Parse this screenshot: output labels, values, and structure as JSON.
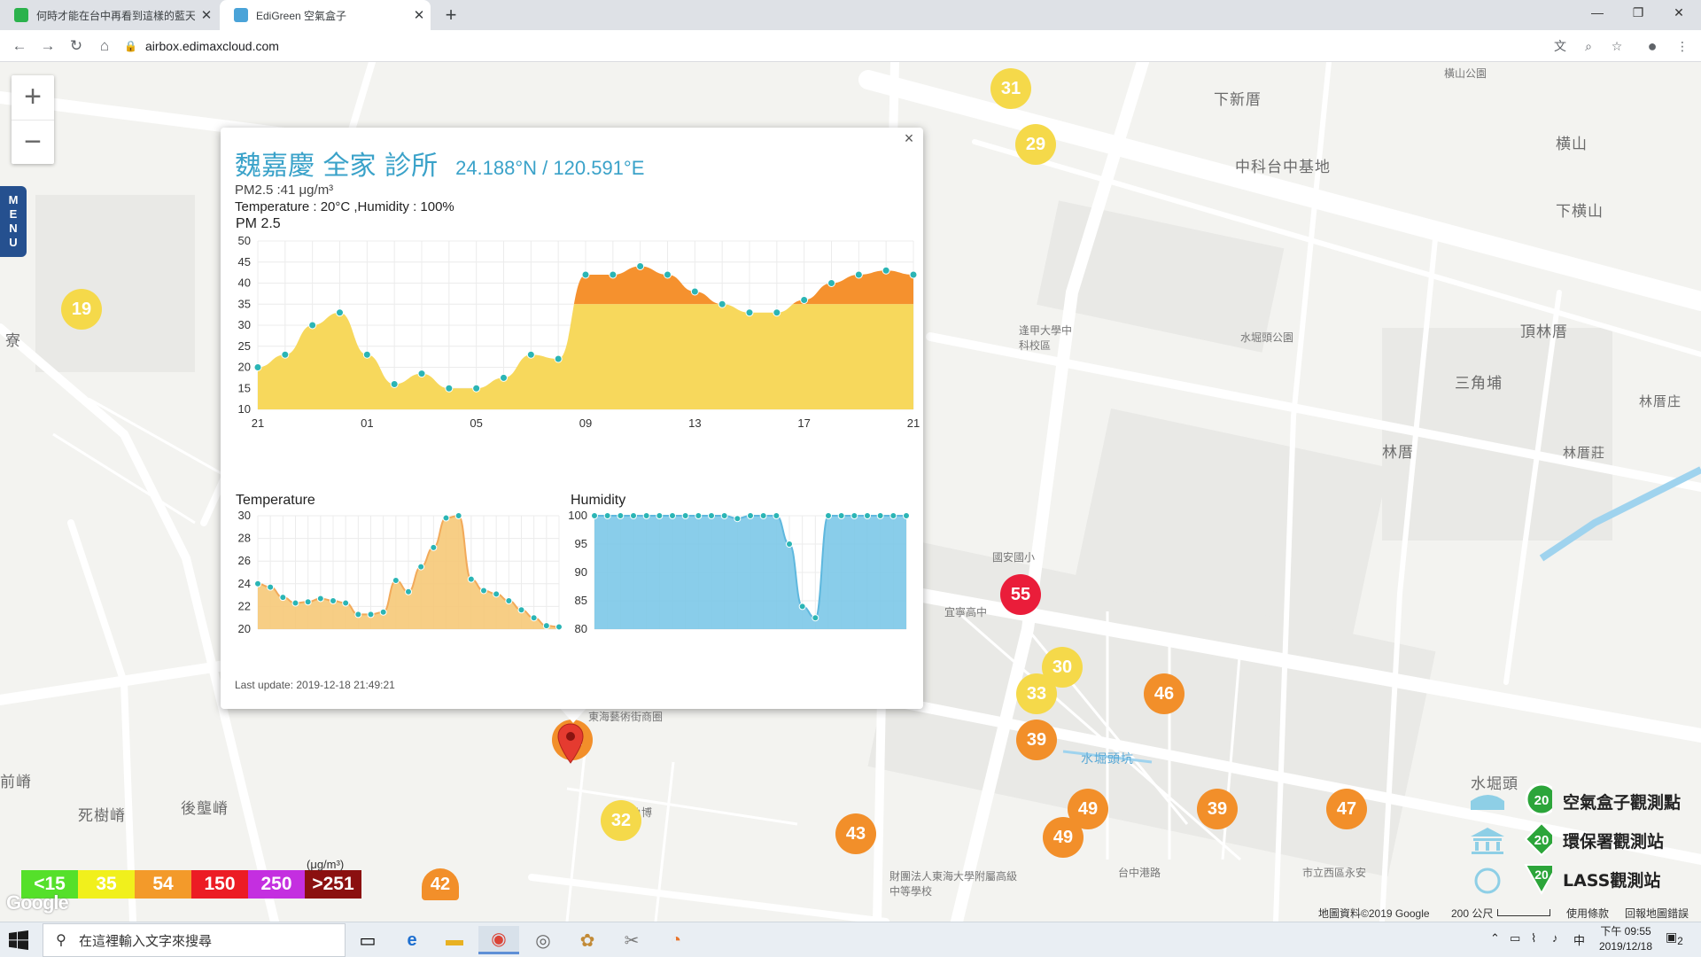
{
  "browser": {
    "tabs": [
      {
        "title": "何時才能在台中再看到這樣的藍天",
        "active": false
      },
      {
        "title": "EdiGreen 空氣盒子",
        "active": true
      }
    ],
    "url": "airbox.edimaxcloud.com"
  },
  "map": {
    "menu_label": "MENU",
    "zoom_in": "+",
    "zoom_out": "−",
    "labels": [
      {
        "text": "下新厝"
      },
      {
        "text": "中科台中基地"
      },
      {
        "text": "横山"
      },
      {
        "text": "下横山"
      },
      {
        "text": "頂林厝"
      },
      {
        "text": "三角埔"
      },
      {
        "text": "林厝"
      },
      {
        "text": "林厝庄"
      },
      {
        "text": "林厝莊"
      },
      {
        "text": "前嵴"
      },
      {
        "text": "死樹嵴"
      },
      {
        "text": "後壟嵴"
      },
      {
        "text": "水堀頭"
      },
      {
        "text": "水堀頭坑"
      },
      {
        "text": "寮"
      },
      {
        "text": "橫山公園"
      },
      {
        "text": "水堀頭公園"
      },
      {
        "text": "逢甲大學中科校區"
      },
      {
        "text": "國安國小"
      },
      {
        "text": "東海藝術街商圈"
      },
      {
        "text": "鯊魚博"
      },
      {
        "text": "財團法人東海大學附屬高級中等學校"
      },
      {
        "text": "台中港路"
      },
      {
        "text": "市立西區永安"
      },
      {
        "text": "宜寧高中"
      }
    ],
    "markers": [
      {
        "value": "31",
        "level": "yellow"
      },
      {
        "value": "29",
        "level": "yellow"
      },
      {
        "value": "19",
        "level": "yellow"
      },
      {
        "value": "55",
        "level": "red"
      },
      {
        "value": "30",
        "level": "yellow"
      },
      {
        "value": "33",
        "level": "yellow"
      },
      {
        "value": "46",
        "level": "orange"
      },
      {
        "value": "39",
        "level": "orange"
      },
      {
        "value": "41",
        "level": "orange"
      },
      {
        "value": "32",
        "level": "yellow"
      },
      {
        "value": "43",
        "level": "orange"
      },
      {
        "value": "49",
        "level": "orange"
      },
      {
        "value": "49",
        "level": "orange"
      },
      {
        "value": "39",
        "level": "orange"
      },
      {
        "value": "47",
        "level": "orange"
      },
      {
        "value": "42",
        "level": "orange"
      }
    ]
  },
  "popup": {
    "station": "魏嘉慶 全家 診所",
    "coords": "24.188°N / 120.591°E",
    "pm_line": "PM2.5 :41 μg/m³",
    "th_line": "Temperature : 20°C ,Humidity : 100%",
    "last_update": "Last update: 2019-12-18 21:49:21",
    "close": "×"
  },
  "chart_data": [
    {
      "type": "area",
      "title": "PM 2.5",
      "x_ticks": [
        "21",
        "01",
        "05",
        "09",
        "13",
        "17",
        "21"
      ],
      "ylim": [
        10,
        50
      ],
      "y_ticks": [
        10,
        15,
        20,
        25,
        30,
        35,
        40,
        45,
        50
      ],
      "values": [
        20,
        23,
        30,
        33,
        23,
        16,
        18.5,
        15,
        15,
        17.5,
        23,
        22,
        42,
        42,
        44,
        42,
        38,
        35,
        33,
        33,
        36,
        40,
        42,
        43,
        42
      ],
      "color_fill": "#f7d85c",
      "color_high": "#f5912e",
      "high_threshold": 35
    },
    {
      "type": "area",
      "title": "Temperature",
      "ylim": [
        20,
        30
      ],
      "y_ticks": [
        20,
        22,
        24,
        26,
        28,
        30
      ],
      "values": [
        24,
        23.7,
        22.8,
        22.3,
        22.4,
        22.7,
        22.5,
        22.3,
        21.3,
        21.3,
        21.5,
        24.3,
        23.3,
        25.5,
        27.2,
        29.8,
        30,
        24.4,
        23.4,
        23.1,
        22.5,
        21.7,
        21,
        20.3,
        20.2
      ],
      "color_fill": "#f6c978",
      "color_line": "#f2aa5a"
    },
    {
      "type": "area",
      "title": "Humidity",
      "ylim": [
        80,
        100
      ],
      "y_ticks": [
        80,
        85,
        90,
        95,
        100
      ],
      "values": [
        100,
        100,
        100,
        100,
        100,
        100,
        100,
        100,
        100,
        100,
        100,
        99.5,
        100,
        100,
        100,
        95,
        84,
        82,
        100,
        100,
        100,
        100,
        100,
        100,
        100
      ],
      "color_fill": "#7cc8e8",
      "color_line": "#5fb8de"
    }
  ],
  "legend": {
    "unit": "(μg/m³)",
    "scale": [
      {
        "label": "<15",
        "color": "#55e02a"
      },
      {
        "label": "35",
        "color": "#f1f01c"
      },
      {
        "label": "54",
        "color": "#f39a2a"
      },
      {
        "label": "150",
        "color": "#ec1c24"
      },
      {
        "label": "250",
        "color": "#c42fe0"
      },
      {
        "label": ">251",
        "color": "#8b1010"
      }
    ],
    "stations": [
      {
        "value": "20",
        "label": "空氣盒子觀測點"
      },
      {
        "value": "20",
        "label": "環保署觀測站"
      },
      {
        "value": "20",
        "label": "LASS觀測站"
      }
    ],
    "google": "Google"
  },
  "attribution": {
    "data": "地圖資料©2019 Google",
    "scale": "200 公尺",
    "terms": "使用條款",
    "report": "回報地圖錯誤"
  },
  "taskbar": {
    "search_placeholder": "在這裡輸入文字來搜尋",
    "ime": "中",
    "time": "下午 09:55",
    "date": "2019/12/18",
    "notif": "2"
  }
}
